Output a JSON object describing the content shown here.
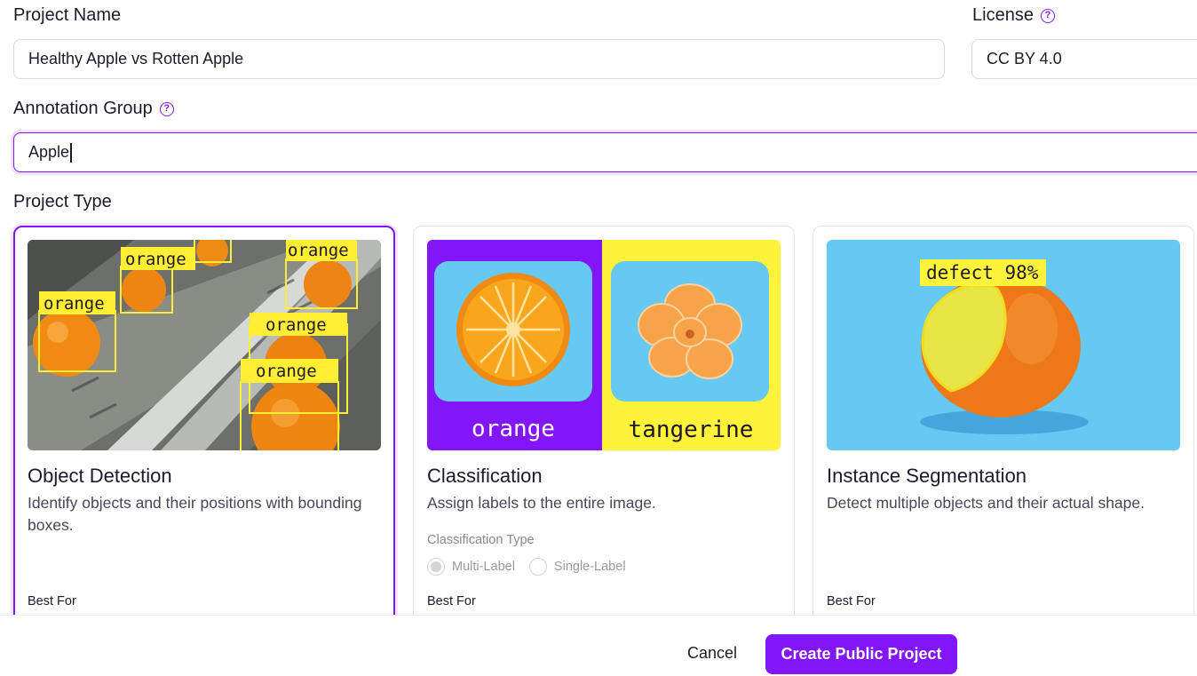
{
  "project_name": {
    "label": "Project Name",
    "value": "Healthy Apple vs Rotten Apple"
  },
  "license": {
    "label": "License",
    "value": "CC BY 4.0"
  },
  "annotation_group": {
    "label": "Annotation Group",
    "value": "Apple"
  },
  "project_type": {
    "label": "Project Type"
  },
  "cards": [
    {
      "title": "Object Detection",
      "description": "Identify objects and their positions with bounding boxes.",
      "best_for": "Best For",
      "image_labels": [
        "orange",
        "orange",
        "orange",
        "orange",
        "orange"
      ]
    },
    {
      "title": "Classification",
      "description": "Assign labels to the entire image.",
      "classification_type_label": "Classification Type",
      "options": [
        "Multi-Label",
        "Single-Label"
      ],
      "selected_option": "Multi-Label",
      "best_for": "Best For",
      "image_labels": [
        "orange",
        "tangerine"
      ]
    },
    {
      "title": "Instance Segmentation",
      "description": "Detect multiple objects and their actual shape.",
      "best_for": "Best For",
      "image_labels": [
        "defect 98%"
      ]
    }
  ],
  "footer": {
    "cancel": "Cancel",
    "create": "Create Public Project"
  },
  "colors": {
    "accent": "#8315f9",
    "highlight": "#fff23a",
    "sky": "#66c9f2"
  },
  "icons": {
    "help": "help-circle-icon"
  }
}
